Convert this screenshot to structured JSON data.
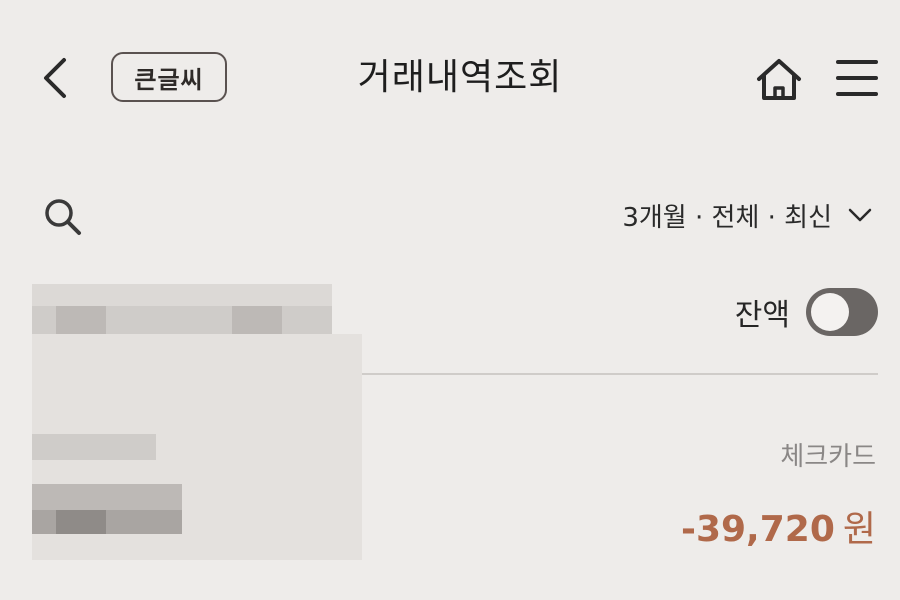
{
  "header": {
    "back_icon": "chevron-left-icon",
    "bigtext_label": "큰글씨",
    "title": "거래내역조회",
    "home_icon": "home-icon",
    "menu_icon": "hamburger-menu-icon"
  },
  "toolbar": {
    "search_icon": "search-icon",
    "filter_label": "3개월 · 전체 · 최신",
    "filter_icon": "chevron-down-icon"
  },
  "balance": {
    "label": "잔액",
    "toggle_on": false
  },
  "transaction": {
    "type": "체크카드",
    "amount": "-39,720",
    "unit": "원",
    "amount_color": "#b0694a"
  },
  "colors": {
    "background": "#eeecea",
    "accent": "#b0694a",
    "toggle": "#6a6664"
  }
}
